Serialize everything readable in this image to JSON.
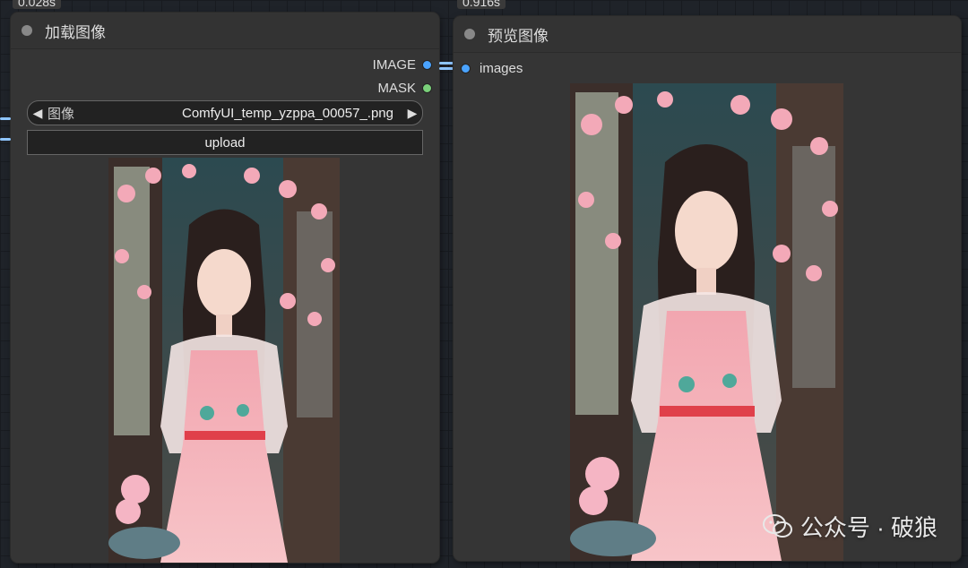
{
  "timers": {
    "left": "0.028s",
    "right": "0.916s"
  },
  "load_node": {
    "title": "加载图像",
    "outputs": [
      {
        "label": "IMAGE",
        "color": "#4aa3ff"
      },
      {
        "label": "MASK",
        "color": "#7ad07a"
      }
    ],
    "image_widget": {
      "label": "图像",
      "value": "ComfyUI_temp_yzppa_00057_.png",
      "left_arrow": "◀",
      "right_arrow": "▶"
    },
    "upload_label": "upload"
  },
  "preview_node": {
    "title": "预览图像",
    "inputs": [
      {
        "label": "images",
        "color": "#4aa3ff"
      }
    ]
  },
  "watermark": {
    "text": "公众号 · 破狼",
    "icon": "wechat-icon"
  },
  "colors": {
    "link": "#8ec5ff",
    "node_bg": "#353535"
  }
}
